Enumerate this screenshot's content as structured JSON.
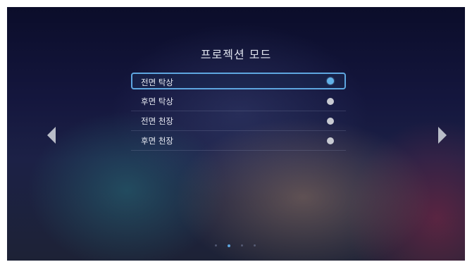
{
  "screen": {
    "title": "프로젝션 모드"
  },
  "menu": {
    "items": [
      {
        "label": "전면 탁상",
        "selected": true
      },
      {
        "label": "후면 탁상",
        "selected": false
      },
      {
        "label": "전면 천장",
        "selected": false
      },
      {
        "label": "후면 천장",
        "selected": false
      }
    ]
  },
  "navigation": {
    "left_icon": "triangle-left-icon",
    "right_icon": "triangle-right-icon"
  },
  "pagination": {
    "page_count": 4,
    "current_page": 2
  },
  "colors": {
    "accent": "#5ea6e0",
    "radio_selected": "#62b2e8",
    "radio_unselected": "#c8cad2"
  }
}
